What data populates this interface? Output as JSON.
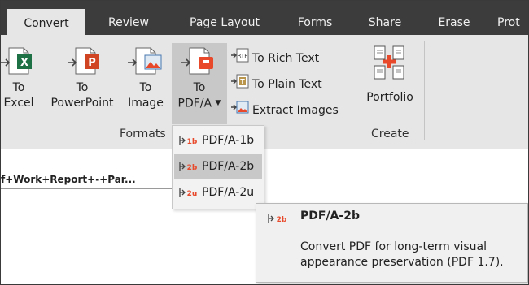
{
  "tabs": [
    {
      "label": "Convert",
      "active": true
    },
    {
      "label": "Review"
    },
    {
      "label": "Page Layout"
    },
    {
      "label": "Forms"
    },
    {
      "label": "Share"
    },
    {
      "label": "Erase"
    },
    {
      "label": "Prot"
    }
  ],
  "ribbon": {
    "formats": {
      "to_excel": {
        "line1": "To",
        "line2": "Excel"
      },
      "to_powerpoint": {
        "line1": "To",
        "line2": "PowerPoint"
      },
      "to_image": {
        "line1": "To",
        "line2": "Image"
      },
      "to_pdfa": {
        "line1": "To",
        "line2": "PDF/A"
      },
      "to_rich_text": "To Rich Text",
      "to_plain_text": "To Plain Text",
      "extract_images": "Extract Images",
      "group_label": "Formats"
    },
    "create": {
      "portfolio": "Portfolio",
      "group_label": "Create"
    }
  },
  "document": {
    "tab_title": "f+Work+Report+-+Par..."
  },
  "dropdown": {
    "items": [
      {
        "label": "PDF/A-1b",
        "icon_text": "1b"
      },
      {
        "label": "PDF/A-2b",
        "icon_text": "2b",
        "highlighted": true
      },
      {
        "label": "PDF/A-2u",
        "icon_text": "2u"
      }
    ]
  },
  "tooltip": {
    "icon_text": "2b",
    "title": "PDF/A-2b",
    "description": "Convert PDF for long-term visual appearance preservation (PDF 1.7)."
  },
  "colors": {
    "tabbar_bg": "#3c3c3c",
    "ribbon_bg": "#e6e6e6",
    "accent_orange": "#e8492b",
    "excel_green": "#1e7145",
    "powerpoint_red": "#d04423"
  }
}
